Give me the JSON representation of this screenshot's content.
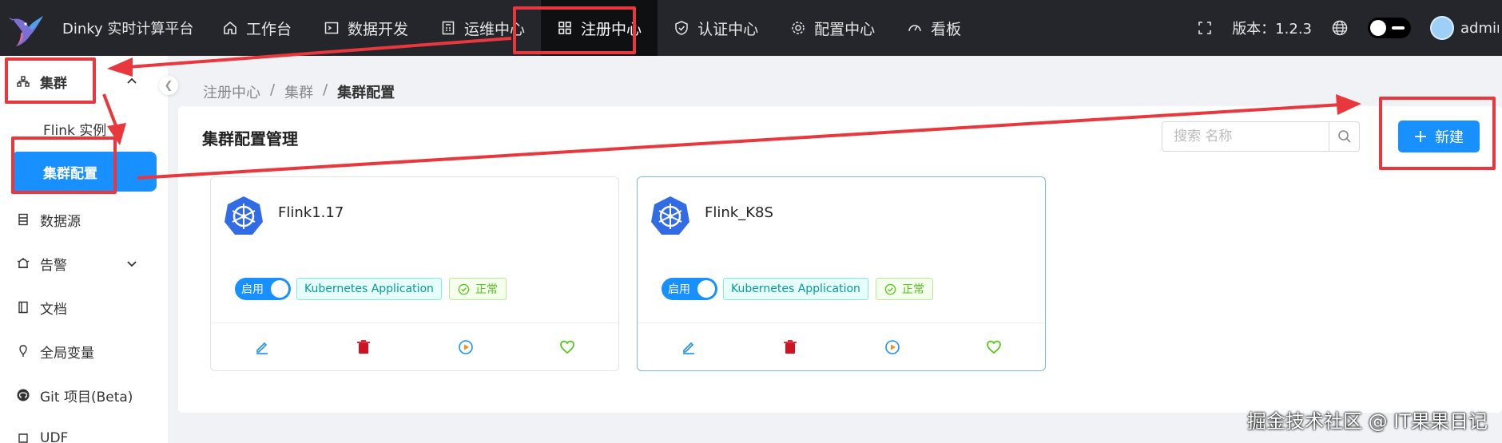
{
  "app": {
    "title": "Dinky 实时计算平台"
  },
  "nav": [
    {
      "label": "工作台",
      "icon": "home-icon"
    },
    {
      "label": "数据开发",
      "icon": "terminal-icon"
    },
    {
      "label": "运维中心",
      "icon": "calculator-icon"
    },
    {
      "label": "注册中心",
      "icon": "appstore-icon",
      "active": true
    },
    {
      "label": "认证中心",
      "icon": "shield-icon"
    },
    {
      "label": "配置中心",
      "icon": "gear-icon"
    },
    {
      "label": "看板",
      "icon": "dashboard-icon"
    }
  ],
  "header": {
    "version": "版本：1.2.3",
    "user": "admin"
  },
  "sidebar": {
    "cluster": "集群",
    "flink_instance": "Flink 实例",
    "cluster_config": "集群配置",
    "datasource": "数据源",
    "alert": "告警",
    "docs": "文档",
    "global_var": "全局变量",
    "git": "Git 项目(Beta)",
    "udf": "UDF"
  },
  "breadcrumb": {
    "root": "注册中心",
    "mid": "集群",
    "current": "集群配置",
    "sep": "/"
  },
  "page": {
    "title": "集群配置管理",
    "search_placeholder": "搜索 名称",
    "new_button": "新建"
  },
  "cards": [
    {
      "name": "Flink1.17",
      "switch_label": "启用",
      "type": "Kubernetes Application",
      "status": "正常"
    },
    {
      "name": "Flink_K8S",
      "switch_label": "启用",
      "type": "Kubernetes Application",
      "status": "正常"
    }
  ],
  "colors": {
    "primary": "#1890ff",
    "annotation": "#e8383d",
    "topbar": "#24262b"
  },
  "watermark": "掘金技术社区 @ IT果果日记"
}
